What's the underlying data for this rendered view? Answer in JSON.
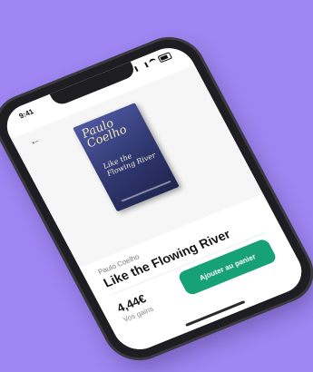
{
  "status": {
    "time": "9:41"
  },
  "nav": {
    "back_label": "←"
  },
  "book": {
    "cover_author": "Paulo Coelho",
    "cover_title": "Like the Flowing River"
  },
  "product": {
    "author": "Paulo Coelho",
    "title": "Like the Flowing River",
    "price": "4,44€",
    "gains_label": "Vos gains",
    "add_to_cart_label": "Ajouter au panier"
  },
  "theme": {
    "background": "#9f86f2",
    "accent": "#17a176"
  }
}
